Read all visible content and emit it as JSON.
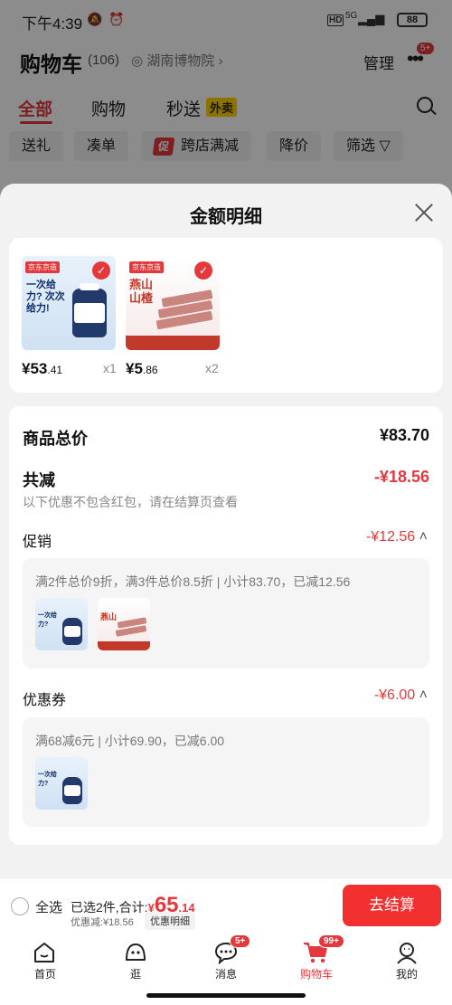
{
  "status_bar": {
    "time": "下午4:39",
    "network": "5G",
    "battery": "88"
  },
  "header": {
    "title": "购物车",
    "count": "(106)",
    "location": "湖南博物院",
    "manage": "管理",
    "more_badge": "5+"
  },
  "tabs": [
    {
      "label": "全部"
    },
    {
      "label": "购物"
    },
    {
      "label": "秒送"
    }
  ],
  "tab_tag": "外卖",
  "chips": [
    {
      "label": "送礼"
    },
    {
      "label": "凑单"
    },
    {
      "label": "跨店满减",
      "badge": "促"
    },
    {
      "label": "降价"
    },
    {
      "label": "筛选"
    }
  ],
  "sheet": {
    "title": "金额明细",
    "products": [
      {
        "brand_tag": "京东京造",
        "headline": "一次给力? 次次给力!",
        "price_int": "¥53",
        "price_dec": ".41",
        "qty": "x1"
      },
      {
        "brand_tag": "京东京造",
        "headline": "燕山 山楂",
        "price_int": "¥5",
        "price_dec": ".86",
        "qty": "x2"
      }
    ],
    "total_label": "商品总价",
    "total_value": "¥83.70",
    "discount_label": "共减",
    "discount_value": "-¥18.56",
    "discount_note": "以下优惠不包含红包，请在结算页查看",
    "promo_label": "促销",
    "promo_value": "-¥12.56",
    "promo_detail": "满2件总价9折，满3件总价8.5折 | 小计83.70，已减12.56",
    "coupon_label": "优惠券",
    "coupon_value": "-¥6.00",
    "coupon_detail": "满68减6元 | 小计69.90，已减6.00"
  },
  "footer": {
    "select_all": "全选",
    "selected_text": "已选2件,合计:",
    "currency": "¥",
    "total_int": "65",
    "total_dec": ".14",
    "saved": "优惠减:¥18.56",
    "detail_btn": "优惠明细",
    "checkout": "去结算"
  },
  "nav": [
    {
      "label": "首页",
      "icon": "home-icon"
    },
    {
      "label": "逛",
      "icon": "browse-icon"
    },
    {
      "label": "消息",
      "icon": "message-icon",
      "badge": "5+"
    },
    {
      "label": "购物车",
      "icon": "cart-icon",
      "badge": "99+"
    },
    {
      "label": "我的",
      "icon": "profile-icon"
    }
  ],
  "colors": {
    "accent": "#e4393c",
    "checkout": "#f23030",
    "tag_yellow": "#ffd200"
  }
}
